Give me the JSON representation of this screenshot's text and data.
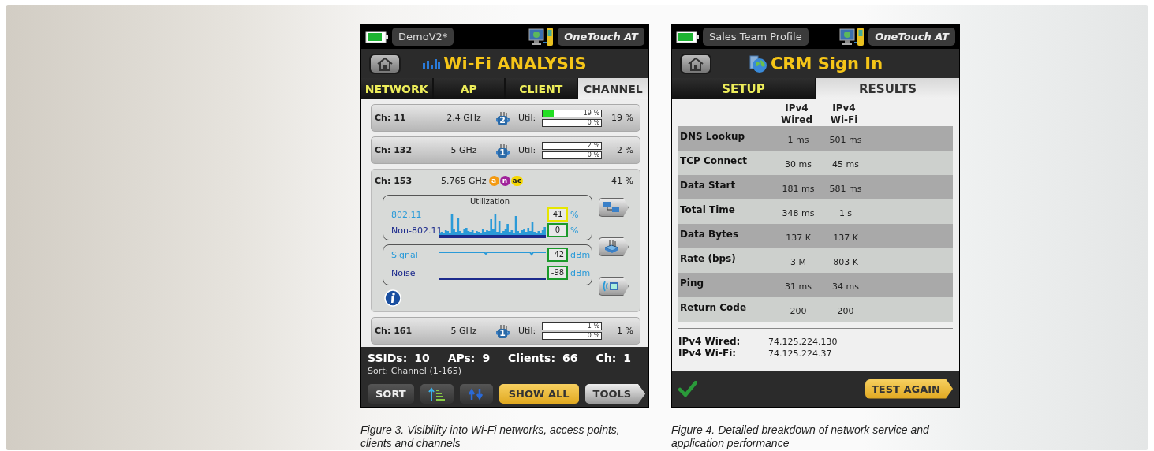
{
  "figures": [
    {
      "kind": "wifi_analysis",
      "caption": "Figure 3. Visibility into Wi-Fi networks, access points, clients and channels",
      "screen": {
        "profile": "DemoV2*",
        "device": "OneTouch AT",
        "title": "Wi-Fi ANALYSIS",
        "tabs": [
          {
            "label": "NETWORK",
            "selected": false
          },
          {
            "label": "AP",
            "selected": false
          },
          {
            "label": "CLIENT",
            "selected": false
          },
          {
            "label": "CHANNEL",
            "selected": true
          }
        ],
        "channels": [
          {
            "channel": "Ch: 11",
            "band": "2.4 GHz",
            "ap_count": "2",
            "util_label": "Util:",
            "expanded": false,
            "util_bars": [
              {
                "level": 0.19,
                "label": "19 %"
              },
              {
                "level": 0,
                "label": "0 %"
              }
            ],
            "reading": "19 %"
          },
          {
            "channel": "Ch: 132",
            "band": "5 GHz",
            "ap_count": "1",
            "util_label": "Util:",
            "expanded": false,
            "util_bars": [
              {
                "level": 0.02,
                "label": "2 %"
              },
              {
                "level": 0,
                "label": "0 %"
              }
            ],
            "reading": "2 %"
          },
          {
            "channel": "Ch: 153",
            "band": "5.765 GHz",
            "expanded": true,
            "badges": [
              {
                "label": "a",
                "color": "#f39a12"
              },
              {
                "label": "n",
                "color": "#a0239a"
              },
              {
                "label": "ac",
                "color": "#f5d800"
              }
            ],
            "reading": "41 %",
            "utilization": {
              "title": "Utilization",
              "rows": [
                {
                  "label": "802.11",
                  "color": "#2a9ad8",
                  "reading": {
                    "value": "41",
                    "unit": "%",
                    "color": "#e6e600"
                  }
                },
                {
                  "label": "Non-802.11",
                  "color": "#1c2a8c",
                  "reading": {
                    "value": "0",
                    "unit": "%",
                    "color": "#1a9a2a"
                  }
                }
              ]
            },
            "signal": {
              "rows": [
                {
                  "label": "Signal",
                  "color": "#2a9ad8",
                  "reading": {
                    "value": "-42",
                    "unit": "dBm",
                    "color": "#1a9a2a"
                  }
                },
                {
                  "label": "Noise",
                  "color": "#1c2a8c",
                  "reading": {
                    "value": "-98",
                    "unit": "dBm",
                    "color": "#1a9a2a"
                  }
                }
              ]
            }
          },
          {
            "channel": "Ch: 161",
            "band": "5 GHz",
            "ap_count": "1",
            "util_label": "Util:",
            "expanded": false,
            "util_bars": [
              {
                "level": 0.01,
                "label": "1 %"
              },
              {
                "level": 0,
                "label": "0 %"
              }
            ],
            "reading": "1 %"
          }
        ],
        "stats": [
          {
            "label": "SSIDs:",
            "value": "10"
          },
          {
            "label": "APs:",
            "value": "9"
          },
          {
            "label": "Clients:",
            "value": "66"
          },
          {
            "label": "Ch:",
            "value": "1"
          }
        ],
        "sort_note": "Sort: Channel (1-165)",
        "buttons": [
          {
            "kind": "plain",
            "label": "SORT"
          },
          {
            "kind": "sort_icon"
          },
          {
            "kind": "refresh_icon"
          },
          {
            "kind": "highlight",
            "label": "SHOW ALL"
          },
          {
            "kind": "arrow",
            "label": "TOOLS"
          }
        ]
      }
    },
    {
      "kind": "test_results",
      "caption": "Figure 4. Detailed breakdown of network service and application performance",
      "screen": {
        "profile": "Sales Team Profile",
        "device": "OneTouch AT",
        "title": "CRM Sign In",
        "tabs": [
          {
            "label": "SETUP",
            "selected": false
          },
          {
            "label": "RESULTS",
            "selected": true
          }
        ],
        "columns": [
          "IPv4 Wired",
          "IPv4 Wi-Fi"
        ],
        "rows": [
          {
            "label": "DNS Lookup",
            "values": [
              "1 ms",
              "501 ms"
            ]
          },
          {
            "label": "TCP Connect",
            "values": [
              "30 ms",
              "45 ms"
            ]
          },
          {
            "label": "Data Start",
            "values": [
              "181 ms",
              "581 ms"
            ]
          },
          {
            "label": "Total Time",
            "values": [
              "348 ms",
              "1 s"
            ]
          },
          {
            "label": "Data Bytes",
            "values": [
              "137 K",
              "137 K"
            ]
          },
          {
            "label": "Rate (bps)",
            "values": [
              "3 M",
              "803 K"
            ]
          },
          {
            "label": "Ping",
            "values": [
              "31 ms",
              "34 ms"
            ]
          },
          {
            "label": "Return Code",
            "values": [
              "200",
              "200"
            ]
          }
        ],
        "addresses": [
          {
            "label": "IPv4 Wired:",
            "value": "74.125.224.130"
          },
          {
            "label": "IPv4 Wi-Fi:",
            "value": "74.125.224.37"
          }
        ],
        "passed": true,
        "action": "TEST AGAIN"
      }
    }
  ]
}
